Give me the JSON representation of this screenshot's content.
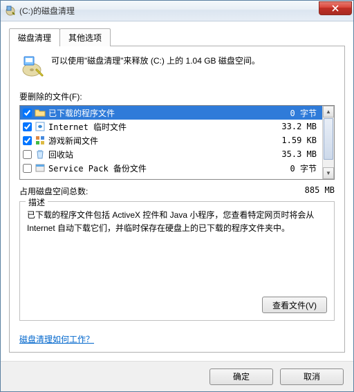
{
  "window": {
    "title": "(C:)的磁盘清理"
  },
  "tabs": {
    "cleanup": "磁盘清理",
    "other": "其他选项"
  },
  "intro": "可以使用\"磁盘清理\"来释放  (C:) 上的 1.04 GB 磁盘空间。",
  "list_label": "要删除的文件(F):",
  "rows": [
    {
      "checked": true,
      "name": "已下载的程序文件",
      "size": "0 字节",
      "icon": "folder"
    },
    {
      "checked": true,
      "name": "Internet 临时文件",
      "size": "33.2 MB",
      "icon": "ie"
    },
    {
      "checked": true,
      "name": "游戏新闻文件",
      "size": "1.59 KB",
      "icon": "game"
    },
    {
      "checked": false,
      "name": "回收站",
      "size": "35.3 MB",
      "icon": "recycle"
    },
    {
      "checked": false,
      "name": "Service Pack 备份文件",
      "size": "0 字节",
      "icon": "sp"
    }
  ],
  "total": {
    "label": "占用磁盘空间总数:",
    "value": "885 MB"
  },
  "description": {
    "legend": "描述",
    "text": "已下载的程序文件包括 ActiveX 控件和 Java 小程序，您查看特定网页时将会从 Internet 自动下载它们，并临时保存在硬盘上的已下载的程序文件夹中。"
  },
  "buttons": {
    "view_files": "查看文件(V)",
    "help_link": "磁盘清理如何工作？",
    "ok": "确定",
    "cancel": "取消"
  }
}
